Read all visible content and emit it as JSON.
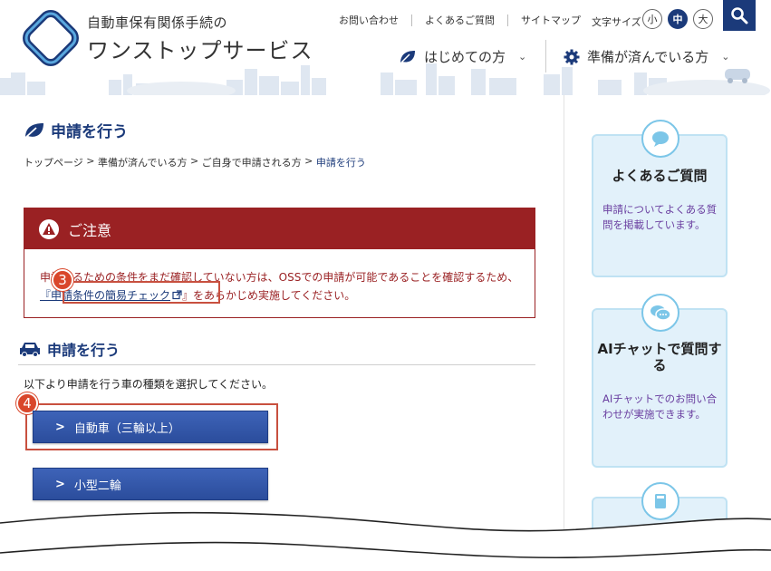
{
  "header": {
    "title_line1": "自動車保有関係手続の",
    "title_line2": "ワンストップサービス",
    "util_links": [
      "お問い合わせ",
      "よくあるご質問",
      "サイトマップ"
    ],
    "fontsize_label": "文字サイズ",
    "fontsize_options": [
      "小",
      "中",
      "大"
    ],
    "nav": [
      {
        "label": "はじめての方"
      },
      {
        "label": "準備が済んでいる方"
      }
    ]
  },
  "main": {
    "page_title": "申請を行う",
    "breadcrumb": [
      "トップページ",
      "準備が済んでいる方",
      "ご自身で申請される方",
      "申請を行う"
    ],
    "notice": {
      "title": "ご注意",
      "body_pre": "申請するための条件をまだ確認していない方は、OSSでの申請が可能であることを確認するため、",
      "link": "『申請条件の簡易チェック",
      "body_post": "』をあらかじめ実施してください。"
    },
    "section_title": "申請を行う",
    "instruction": "以下より申請を行う車の種類を選択してください。",
    "buttons": [
      "自動車（三輪以上）",
      "小型二輪"
    ],
    "markers": [
      "3",
      "4"
    ]
  },
  "sidebar": {
    "cards": [
      {
        "title": "よくあるご質問",
        "text": "申請についてよくある質問を掲載しています。"
      },
      {
        "title": "AIチャットで質問する",
        "text": "AIチャットでのお問い合わせが実施できます。"
      },
      {
        "title": ""
      }
    ]
  },
  "colors": {
    "brand_navy": "#1b3a7a",
    "notice_red": "#9a2123",
    "button_blue": "#2b4d9c",
    "marker_red": "#d9472b",
    "card_bg": "#e2f1fa"
  }
}
